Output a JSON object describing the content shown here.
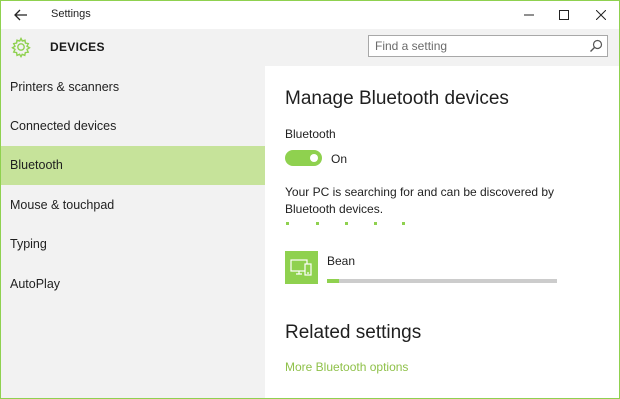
{
  "window": {
    "title": "Settings"
  },
  "header": {
    "section_title": "DEVICES",
    "search_placeholder": "Find a setting"
  },
  "sidebar": {
    "items": [
      {
        "label": "Printers & scanners",
        "active": false
      },
      {
        "label": "Connected devices",
        "active": false
      },
      {
        "label": "Bluetooth",
        "active": true
      },
      {
        "label": "Mouse & touchpad",
        "active": false
      },
      {
        "label": "Typing",
        "active": false
      },
      {
        "label": "AutoPlay",
        "active": false
      }
    ]
  },
  "main": {
    "heading": "Manage Bluetooth devices",
    "bluetooth_label": "Bluetooth",
    "toggle_state": "On",
    "description": "Your PC is searching for and can be discovered by Bluetooth devices.",
    "devices": [
      {
        "name": "Bean",
        "icon": "device-icon",
        "progress": 0.05
      }
    ],
    "related_heading": "Related settings",
    "related_link": "More Bluetooth options"
  },
  "colors": {
    "accent": "#8fd14f",
    "active_nav": "#c6e39a",
    "link": "#8fc14a",
    "sidebar_bg": "#f2f2f2"
  },
  "icons": [
    "back-arrow-icon",
    "minimize-icon",
    "maximize-icon",
    "close-icon",
    "gear-icon",
    "search-icon",
    "device-icon"
  ]
}
